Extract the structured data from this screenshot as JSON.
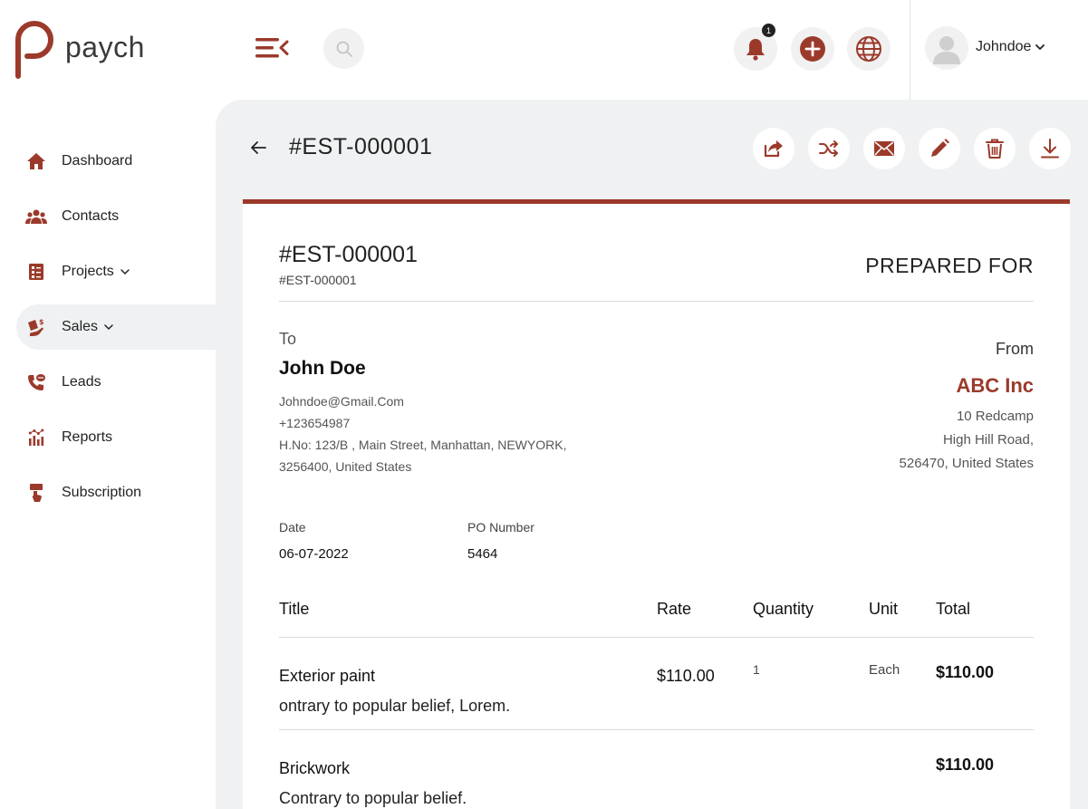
{
  "brand": {
    "name": "paych",
    "color": "#9b3a2b"
  },
  "header": {
    "notification_count": "1",
    "username": "Johndoe"
  },
  "sidebar": {
    "items": [
      {
        "label": "Dashboard",
        "icon": "home-icon"
      },
      {
        "label": "Contacts",
        "icon": "users-icon"
      },
      {
        "label": "Projects",
        "icon": "projects-icon",
        "has_submenu": true
      },
      {
        "label": "Sales",
        "icon": "sales-icon",
        "has_submenu": true,
        "active": true
      },
      {
        "label": "Leads",
        "icon": "phone-icon"
      },
      {
        "label": "Reports",
        "icon": "chart-icon"
      },
      {
        "label": "Subscription",
        "icon": "subscription-icon"
      }
    ]
  },
  "page": {
    "title": "#EST-000001",
    "actions": [
      "share-icon",
      "shuffle-icon",
      "mail-icon",
      "edit-icon",
      "trash-icon",
      "download-icon"
    ]
  },
  "estimate": {
    "number": "#EST-000001",
    "sub_number": "#EST-000001",
    "prepared_for": "PREPARED FOR",
    "to": {
      "label": "To",
      "name": "John Doe",
      "email": "Johndoe@Gmail.Com",
      "phone": "+123654987",
      "address_line1": "H.No: 123/B , Main Street, Manhattan, NEWYORK,",
      "address_line2": "3256400, United States"
    },
    "from": {
      "label": "From",
      "name": "ABC Inc",
      "address_line1": "10 Redcamp",
      "address_line2": "High Hill Road,",
      "address_line3": "526470, United States"
    },
    "date_label": "Date",
    "date": "06-07-2022",
    "po_label": "PO Number",
    "po_number": "5464",
    "columns": {
      "title": "Title",
      "rate": "Rate",
      "quantity": "Quantity",
      "unit": "Unit",
      "total": "Total"
    },
    "items": [
      {
        "title": "Exterior paint",
        "description": "ontrary to popular belief, Lorem.",
        "rate": "$110.00",
        "quantity": "1",
        "unit": "Each",
        "total": "$110.00"
      },
      {
        "title": "Brickwork",
        "description": "Contrary to popular belief.",
        "rate": "",
        "quantity": "",
        "unit": "",
        "total": "$110.00"
      }
    ]
  }
}
